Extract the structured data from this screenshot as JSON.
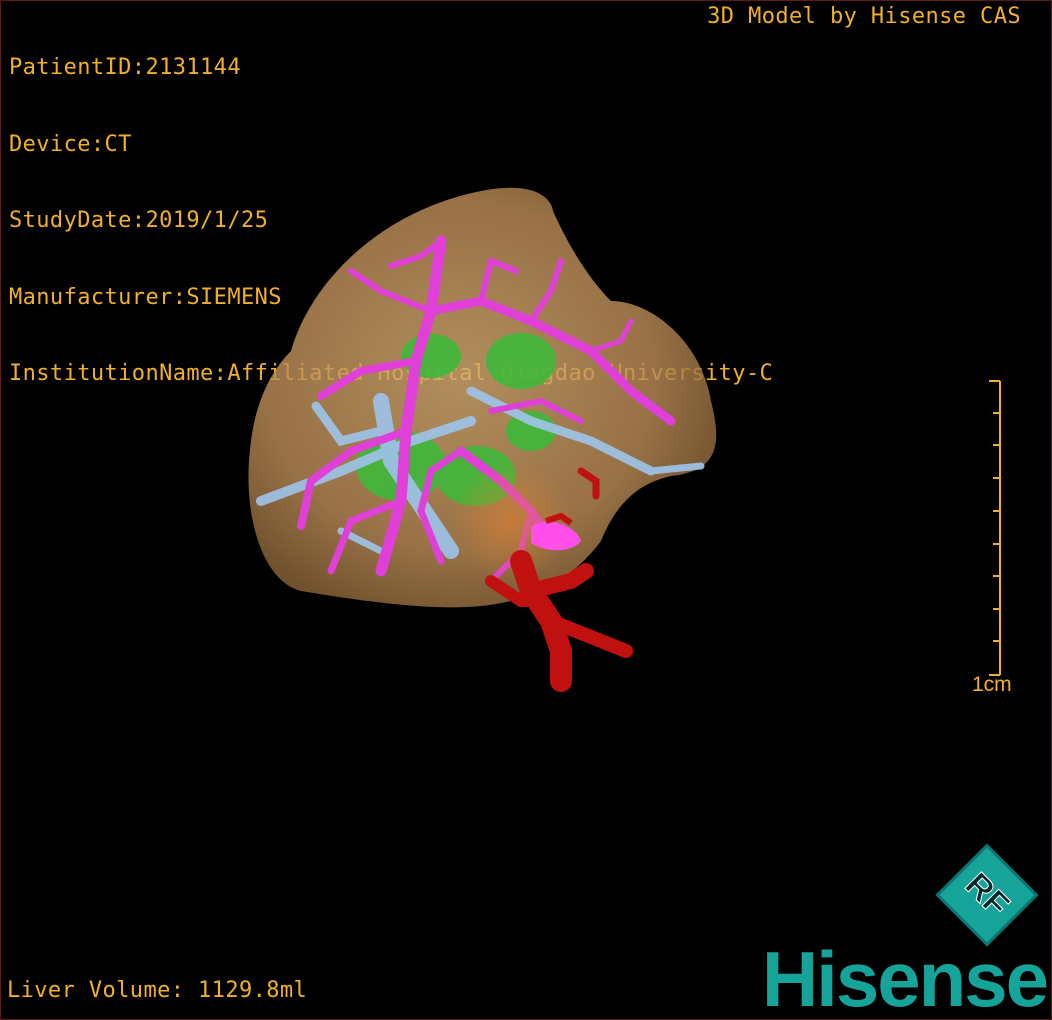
{
  "patient_info": [
    "PatientID:2131144",
    "Device:CT",
    "StudyDate:2019/1/25",
    "Manufacturer:SIEMENS",
    "InstitutionName:Affiliated Hospital Qingdao University-C"
  ],
  "header_right": "3D Model by Hisense CAS",
  "scale_bar": {
    "label": "1cm"
  },
  "footer": {
    "liver_volume": "Liver Volume: 1129.8ml"
  },
  "logo": {
    "badge_text": "RF",
    "brand": "Hisense"
  },
  "colors": {
    "overlay_text": "#f0b02a",
    "liver": "#c89a62",
    "portal_vein": "#e040d8",
    "hepatic_vein": "#9ec3e8",
    "lesion": "#3fb83a",
    "artery": "#c01010",
    "brand": "#16a39a"
  },
  "icons": [
    "liver-3d-model",
    "rf-badge-icon",
    "hisense-logo"
  ]
}
